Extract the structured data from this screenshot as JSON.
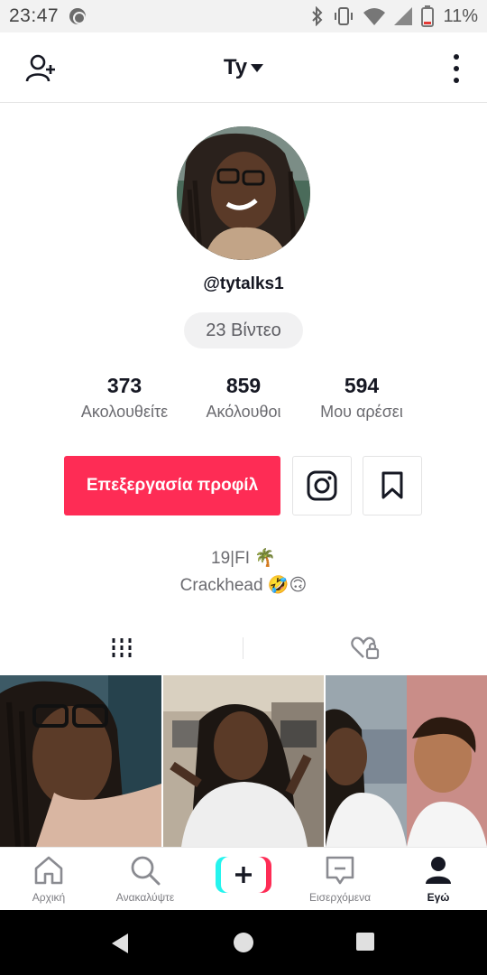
{
  "status_bar": {
    "time": "23:47",
    "battery_percent": "11%"
  },
  "header": {
    "title": "Ty"
  },
  "profile": {
    "username": "@tytalks1",
    "video_count_label": "23 Βίντεο",
    "stats": [
      {
        "value": "373",
        "label": "Ακολουθείτε"
      },
      {
        "value": "859",
        "label": "Ακόλουθοι"
      },
      {
        "value": "594",
        "label": "Μου αρέσει"
      }
    ],
    "edit_button_label": "Επεξεργασία προφίλ",
    "bio_line_1": "19|FI 🌴",
    "bio_line_2": "Crackhead 🤣🙃"
  },
  "colors": {
    "brand_red": "#fe2c55",
    "brand_cyan": "#25f4ee",
    "text_primary": "#161823",
    "text_secondary": "#6b6b70"
  },
  "bottom_nav": [
    {
      "label": "Αρχική",
      "icon": "home-icon"
    },
    {
      "label": "Ανακαλύψτε",
      "icon": "search-icon"
    },
    {
      "label": "",
      "icon": "create-plus-icon"
    },
    {
      "label": "Εισερχόμενα",
      "icon": "inbox-icon"
    },
    {
      "label": "Εγώ",
      "icon": "profile-icon"
    }
  ]
}
